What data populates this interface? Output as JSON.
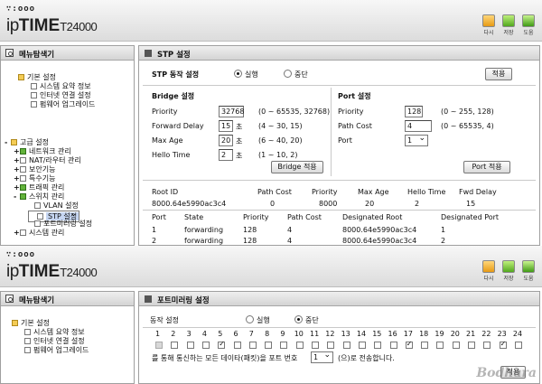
{
  "logo": {
    "dots": "∵:ooo",
    "ip": "ip",
    "time": "TIME",
    "model": "T24000"
  },
  "header_buttons": [
    {
      "label": "다시",
      "icon": "refresh-icon",
      "color": "orange"
    },
    {
      "label": "저장",
      "icon": "save-icon",
      "color": "green"
    },
    {
      "label": "도움",
      "icon": "help-icon",
      "color": "green2"
    }
  ],
  "sidebar": {
    "title": "메뉴탐색기"
  },
  "frame1": {
    "tree": [
      {
        "pm": "",
        "icon": "folder",
        "label": "기본 설정"
      },
      {
        "pm": "",
        "icon": "page",
        "label": "시스템 요약 정보"
      },
      {
        "pm": "",
        "icon": "page",
        "label": "인터넷 연결 설정"
      },
      {
        "pm": "",
        "icon": "page",
        "label": "펌웨어 업그레이드"
      },
      {
        "pm": "-",
        "icon": "folder",
        "label": "고급 설정"
      },
      {
        "pm": "+",
        "icon": "grn",
        "label": "네트워크 관리"
      },
      {
        "pm": "+",
        "icon": "page",
        "label": "NAT/라우터 관리"
      },
      {
        "pm": "+",
        "icon": "page",
        "label": "보안기능"
      },
      {
        "pm": "+",
        "icon": "page",
        "label": "특수기능"
      },
      {
        "pm": "+",
        "icon": "grn",
        "label": "트래픽 관리"
      },
      {
        "pm": "-",
        "icon": "grn",
        "label": "스위치 관리"
      },
      {
        "pm": "",
        "icon": "page",
        "label": "VLAN 설정"
      },
      {
        "pm": "",
        "icon": "page",
        "label": "STP 설정"
      },
      {
        "pm": "",
        "icon": "page",
        "label": "포트미러링 설정"
      },
      {
        "pm": "+",
        "icon": "page",
        "label": "시스템 관리"
      }
    ],
    "title": "STP 설정",
    "op_label": "STP 동작 설정",
    "run": "실행",
    "stop": "중단",
    "apply": "적용",
    "bridge": {
      "title": "Bridge 설정",
      "rows": [
        {
          "label": "Priority",
          "value": "32768",
          "unit": "",
          "range": "(0 ~ 65535, 32768)"
        },
        {
          "label": "Forward Delay",
          "value": "15",
          "unit": "초",
          "range": "(4 ~ 30, 15)"
        },
        {
          "label": "Max Age",
          "value": "20",
          "unit": "초",
          "range": "(6 ~ 40, 20)"
        },
        {
          "label": "Hello Time",
          "value": "2",
          "unit": "초",
          "range": "(1 ~ 10, 2)"
        }
      ],
      "apply": "Bridge 적용"
    },
    "port": {
      "title": "Port 설정",
      "rows": [
        {
          "label": "Priority",
          "value": "128",
          "range": "(0 ~ 255, 128)"
        },
        {
          "label": "Path Cost",
          "value": "4",
          "range": "(0 ~ 65535, 4)"
        },
        {
          "label": "Port",
          "value": "1",
          "range": ""
        }
      ],
      "apply": "Port 적용"
    },
    "root": {
      "headers": [
        "Root ID",
        "Path Cost",
        "Priority",
        "Max Age",
        "Hello Time",
        "Fwd Delay"
      ],
      "values": [
        "8000.64e5990ac3c4",
        "0",
        "8000",
        "20",
        "2",
        "15"
      ]
    },
    "ports": {
      "headers": [
        "Port",
        "State",
        "Priority",
        "Path Cost",
        "Designated Root",
        "Designated Port"
      ],
      "rows": [
        [
          "1",
          "forwarding",
          "128",
          "4",
          "8000.64e5990ac3c4",
          "1"
        ],
        [
          "2",
          "forwarding",
          "128",
          "4",
          "8000.64e5990ac3c4",
          "2"
        ]
      ]
    }
  },
  "frame2": {
    "tree": [
      {
        "icon": "folder",
        "label": "기본 설정"
      },
      {
        "icon": "page",
        "label": "시스템 요약 정보"
      },
      {
        "icon": "page",
        "label": "인터넷 연결 설정"
      },
      {
        "icon": "page",
        "label": "펌웨어 업그레이드"
      }
    ],
    "title": "포트미러링 설정",
    "op_label": "동작 설정",
    "run": "실행",
    "stop": "중단",
    "ports": [
      "1",
      "2",
      "3",
      "4",
      "5",
      "6",
      "7",
      "8",
      "9",
      "10",
      "11",
      "12",
      "13",
      "14",
      "15",
      "16",
      "17",
      "18",
      "19",
      "20",
      "21",
      "22",
      "23",
      "24"
    ],
    "checked": [
      5,
      17,
      23
    ],
    "disabled": [
      1
    ],
    "sentence_pre": "를 통해 통신하는 모든 데이타(패킷)을 포트 번호",
    "target_port": "1",
    "sentence_post": "(으)로 전송합니다.",
    "apply": "적용"
  },
  "watermark": "Bodhara"
}
